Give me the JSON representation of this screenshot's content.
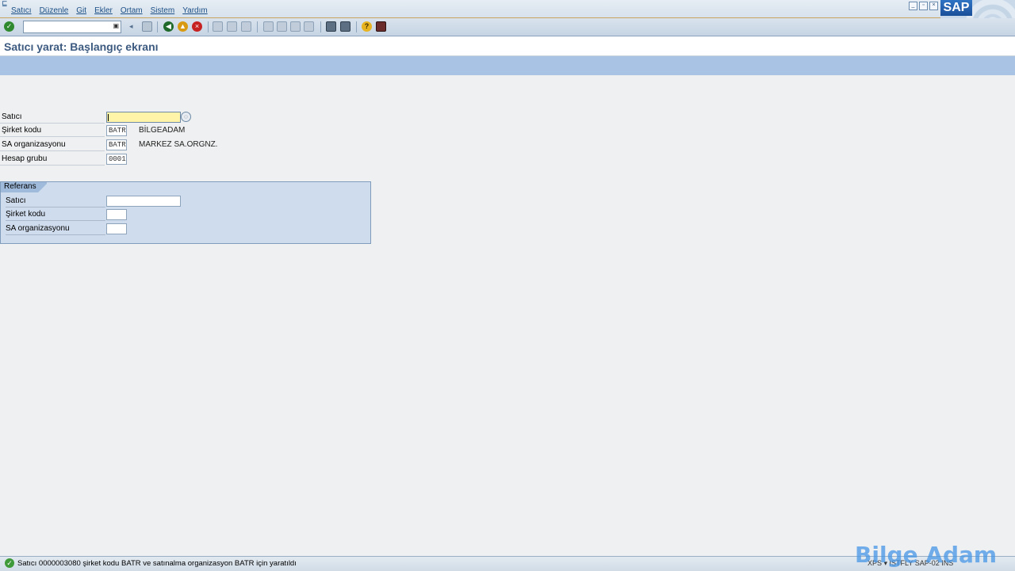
{
  "menu": {
    "items": [
      "Satıcı",
      "Düzenle",
      "Git",
      "Ekler",
      "Ortam",
      "Sistem",
      "Yardım"
    ]
  },
  "logo": {
    "text": "SAP"
  },
  "toolbar": {
    "command_field_value": "",
    "icons": [
      "enter-icon",
      "back-icon",
      "exit-icon",
      "cancel-icon",
      "save-icon",
      "print-icon",
      "find-icon",
      "find-next-icon",
      "first-page-icon",
      "previous-page-icon",
      "next-page-icon",
      "last-page-icon",
      "create-session-icon",
      "shortcut-icon",
      "help-icon",
      "layout-menu-icon"
    ]
  },
  "title": "Satıcı yarat: Başlangıç ekranı",
  "fields": {
    "vendor": {
      "label": "Satıcı",
      "value": ""
    },
    "company_code": {
      "label": "Şirket kodu",
      "value": "BATR",
      "description": "BİLGEADAM"
    },
    "purch_org": {
      "label": "SA organizasyonu",
      "value": "BATR",
      "description": "MARKEZ SA.ORGNZ."
    },
    "account_group": {
      "label": "Hesap grubu",
      "value": "0001"
    }
  },
  "reference": {
    "title": "Referans",
    "vendor": {
      "label": "Satıcı",
      "value": ""
    },
    "company_code": {
      "label": "Şirket kodu",
      "value": ""
    },
    "purch_org": {
      "label": "SA organizasyonu",
      "value": ""
    }
  },
  "status": {
    "message": "Satıcı 0000003080 şirket kodu BATR ve satınalma organizasyon BATR için yaratıldı",
    "system_info": "XPS ▾  ISTFLY  SAP-02  INS"
  },
  "watermark": "Bilge Adam",
  "colors": {
    "menu_text": "#1b4f86",
    "title_text": "#3d5a80",
    "app_toolbar": "#a8c3e4",
    "required_field": "#fff4a8",
    "status_ok": "#3f9a3a"
  }
}
